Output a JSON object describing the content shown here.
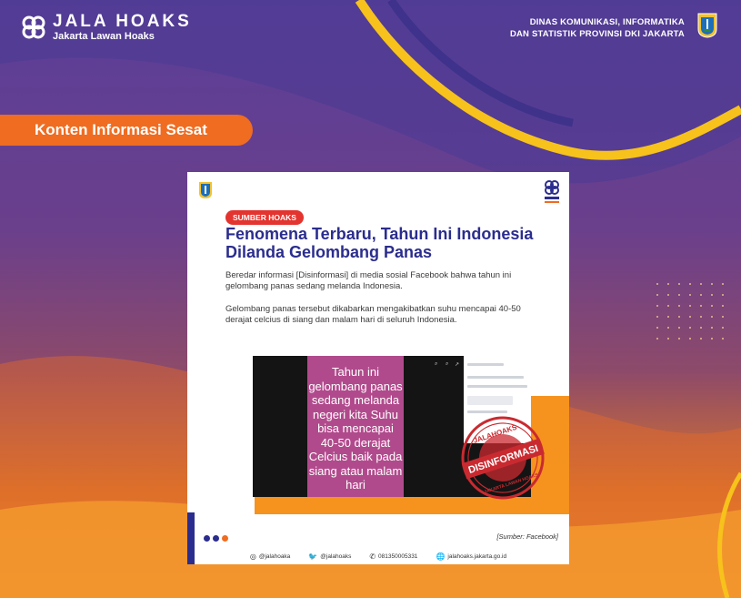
{
  "header": {
    "brand_name": "JALA HOAKS",
    "brand_tagline": "Jakarta Lawan Hoaks",
    "agency_line1": "DINAS KOMUNIKASI, INFORMATIKA",
    "agency_line2": "DAN STATISTIK PROVINSI DKI JAKARTA"
  },
  "category_label": "Konten Informasi Sesat",
  "card": {
    "badge": "SUMBER HOAKS",
    "title": "Fenomena Terbaru, Tahun Ini Indonesia Dilanda Gelombang Panas",
    "paragraph1": "Beredar informasi [Disinformasi] di media sosial Facebook bahwa tahun ini gelombang panas sedang melanda Indonesia.",
    "paragraph2": "Gelombang panas tersebut dikabarkan mengakibatkan suhu mencapai 40-50 derajat celcius di siang dan malam hari di seluruh Indonesia.",
    "screenshot_text": "Tahun ini gelombang panas sedang melanda negeri kita Suhu bisa mencapai 40-50 derajat Celcius baik pada siang atau malam hari",
    "stamp_text_top": "JALAHOAKS",
    "stamp_text_main": "DISINFORMASI",
    "stamp_text_bottom": "JAKARTA LAWAN HOAKS",
    "source": "[Sumber: Facebook]",
    "contacts": {
      "instagram": "@jalahoaka",
      "twitter": "@jalahoaks",
      "whatsapp": "081350005331",
      "web": "jalahoaks.jakarta.go.id"
    }
  },
  "colors": {
    "orange": "#ef6c21",
    "navy": "#2b2d8e",
    "red": "#e3342f",
    "purple_bg": "#5a3f98",
    "yellow_wave": "#f7c21b"
  }
}
